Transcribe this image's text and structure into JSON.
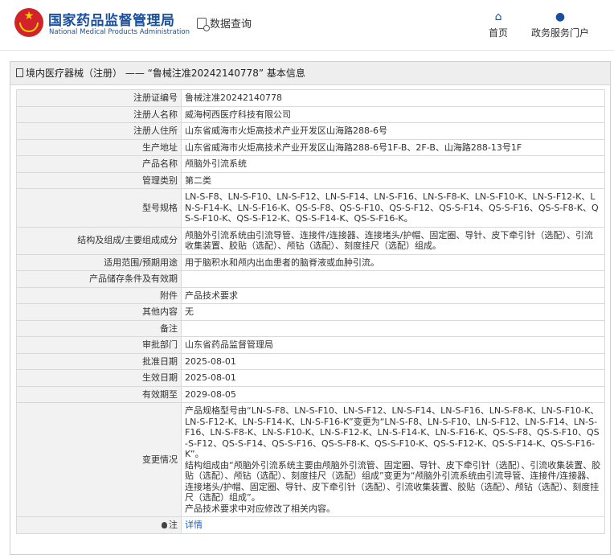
{
  "header": {
    "site_title": "国家药品监督管理局",
    "site_subtitle": "National Medical Products Administration",
    "query_label": "数据查询",
    "nav_home": "首页",
    "nav_portal": "政务服务门户",
    "icons": {
      "logo": "national-emblem",
      "query": "search-doc-icon",
      "home": "home-icon",
      "portal": "user-icon"
    },
    "colors": {
      "brand": "#1a4f9c",
      "emblem": "#d2232a"
    }
  },
  "panel": {
    "title": "境内医疗器械（注册） —— “鲁械注准20242140778” 基本信息"
  },
  "rows": [
    {
      "label": "注册证编号",
      "value": "鲁械注准20242140778"
    },
    {
      "label": "注册人名称",
      "value": "威海柯西医疗科技有限公司"
    },
    {
      "label": "注册人住所",
      "value": "山东省威海市火炬高技术产业开发区山海路288-6号"
    },
    {
      "label": "生产地址",
      "value": "山东省威海市火炬高技术产业开发区山海路288-6号1F-B、2F-B、山海路288-13号1F"
    },
    {
      "label": "产品名称",
      "value": "颅脑外引流系统"
    },
    {
      "label": "管理类别",
      "value": "第二类"
    },
    {
      "label": "型号规格",
      "value": "LN-S-F8、LN-S-F10、LN-S-F12、LN-S-F14、LN-S-F16、LN-S-F8-K、LN-S-F10-K、LN-S-F12-K、LN-S-F14-K、LN-S-F16-K、QS-S-F8、QS-S-F10、QS-S-F12、QS-S-F14、QS-S-F16、QS-S-F8-K、QS-S-F10-K、QS-S-F12-K、QS-S-F14-K、QS-S-F16-K。"
    },
    {
      "label": "结构及组成/主要组成成分",
      "value": "颅脑外引流系统由引流导管、连接件/连接器、连接堵头/护帽、固定圈、导针、皮下牵引针（选配）、引流收集装置、胶贴（选配）、颅钻（选配）、刻度挂尺（选配）组成。"
    },
    {
      "label": "适用范围/预期用途",
      "value": "用于脑积水和颅内出血患者的脑脊液或血肿引流。"
    },
    {
      "label": "产品储存条件及有效期",
      "value": ""
    },
    {
      "label": "附件",
      "value": "产品技术要求"
    },
    {
      "label": "其他内容",
      "value": "无"
    },
    {
      "label": "备注",
      "value": ""
    },
    {
      "label": "审批部门",
      "value": "山东省药品监督管理局"
    },
    {
      "label": "批准日期",
      "value": "2025-08-01"
    },
    {
      "label": "生效日期",
      "value": "2025-08-01"
    },
    {
      "label": "有效期至",
      "value": "2029-08-05"
    },
    {
      "label": "变更情况",
      "value": "产品规格型号由“LN-S-F8、LN-S-F10、LN-S-F12、LN-S-F14、LN-S-F16、LN-S-F8-K、LN-S-F10-K、LN-S-F12-K、LN-S-F14-K、LN-S-F16-K”变更为“LN-S-F8、LN-S-F10、LN-S-F12、LN-S-F14、LN-S-F16、LN-S-F8-K、LN-S-F10-K、LN-S-F12-K、LN-S-F14-K、LN-S-F16-K、QS-S-F8、QS-S-F10、QS-S-F12、QS-S-F14、QS-S-F16、QS-S-F8-K、QS-S-F10-K、QS-S-F12-K、QS-S-F14-K、QS-S-F16-K”。\n结构组成由“颅脑外引流系统主要由颅脑外引流管、固定圈、导针、皮下牵引针（选配）、引流收集装置、胶贴（选配）、颅钻（选配）、刻度挂尺（选配）组成”变更为“颅脑外引流系统由引流导管、连接件/连接器、连接堵头/护帽、固定圈、导针、皮下牵引针（选配）、引流收集装置、胶贴（选配）、颅钻（选配）、刻度挂尺（选配）组成”。\n产品技术要求中对应修改了相关内容。"
    }
  ],
  "note_row": {
    "label": "注",
    "link": "详情",
    "icon": "bulb-icon"
  }
}
